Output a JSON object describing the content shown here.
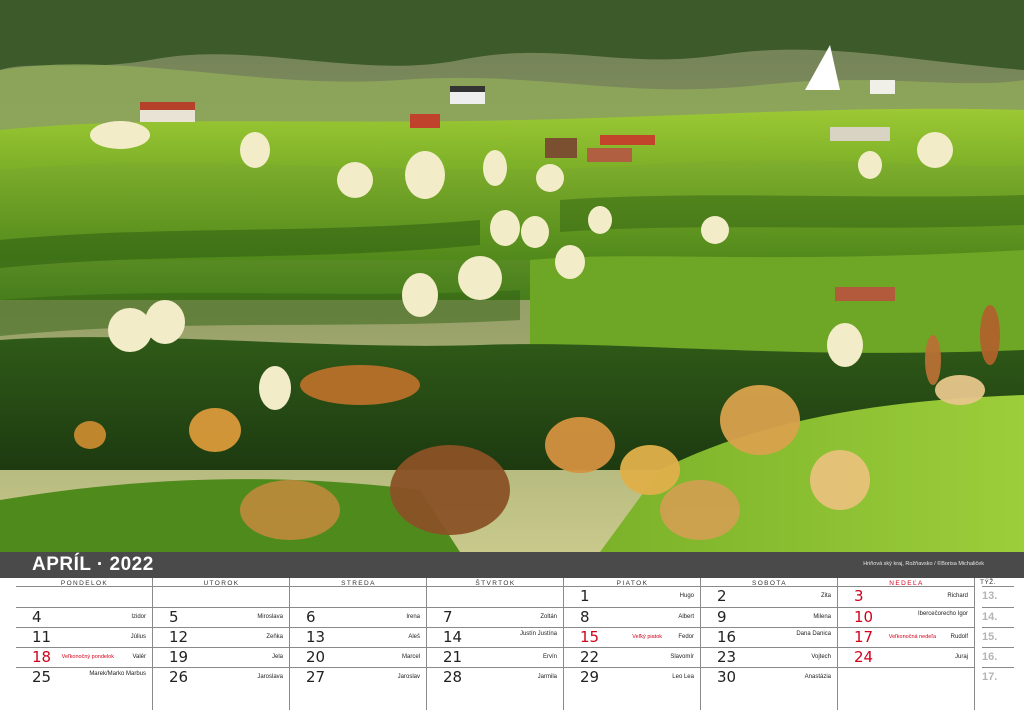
{
  "title": {
    "month_year": "APRÍL · 2022",
    "credit": "Hriňová ský kraj, Rožňavsko / ©Borisa Michaliček"
  },
  "day_headers": [
    "PONDELOK",
    "UTOROK",
    "STREDA",
    "ŠTVRTOK",
    "PIATOK",
    "SOBOTA",
    "NEDEĽA"
  ],
  "week_header": "TÝŽ.",
  "weeks": [
    "13.",
    "14.",
    "15.",
    "16.",
    "17."
  ],
  "columns": [
    [
      {
        "num": "",
        "name": ""
      },
      {
        "num": "4",
        "name": "Izidor"
      },
      {
        "num": "11",
        "name": "Július"
      },
      {
        "num": "18",
        "name": "Valér",
        "holiday": "Veľkonočný pondelok",
        "red": true
      },
      {
        "num": "25",
        "name": "Marek/Marko Marbus"
      }
    ],
    [
      {
        "num": "",
        "name": ""
      },
      {
        "num": "5",
        "name": "Miroslava"
      },
      {
        "num": "12",
        "name": "Zeňka"
      },
      {
        "num": "19",
        "name": "Jela"
      },
      {
        "num": "26",
        "name": "Jaroslava"
      }
    ],
    [
      {
        "num": "",
        "name": ""
      },
      {
        "num": "6",
        "name": "Irena"
      },
      {
        "num": "13",
        "name": "Aleš"
      },
      {
        "num": "20",
        "name": "Marcel"
      },
      {
        "num": "27",
        "name": "Jaroslav"
      }
    ],
    [
      {
        "num": "",
        "name": ""
      },
      {
        "num": "7",
        "name": "Zoltán"
      },
      {
        "num": "14",
        "name": "Justín Justína"
      },
      {
        "num": "21",
        "name": "Ervín"
      },
      {
        "num": "28",
        "name": "Jarmila"
      }
    ],
    [
      {
        "num": "1",
        "name": "Hugo"
      },
      {
        "num": "8",
        "name": "Albert"
      },
      {
        "num": "15",
        "name": "Fedor",
        "holiday": "Veľký piatok",
        "red": true
      },
      {
        "num": "22",
        "name": "Slavomír"
      },
      {
        "num": "29",
        "name": "Leo Lea"
      }
    ],
    [
      {
        "num": "2",
        "name": "Zita"
      },
      {
        "num": "9",
        "name": "Milena"
      },
      {
        "num": "16",
        "name": "Dana Danica"
      },
      {
        "num": "23",
        "name": "Vojtech"
      },
      {
        "num": "30",
        "name": "Anastázia"
      }
    ],
    [
      {
        "num": "3",
        "name": "Richard",
        "red": true
      },
      {
        "num": "10",
        "name": "Ibercečorecho Igor",
        "red": true
      },
      {
        "num": "17",
        "name": "Rudolf",
        "holiday": "Veľkonočná nedeľa",
        "red": true
      },
      {
        "num": "24",
        "name": "Juraj",
        "red": true
      },
      {
        "num": "",
        "name": ""
      }
    ]
  ],
  "colors": {
    "title_bar": "#4a4a4a",
    "holiday_red": "#d0021b",
    "week_gray": "#b5b5b5"
  }
}
